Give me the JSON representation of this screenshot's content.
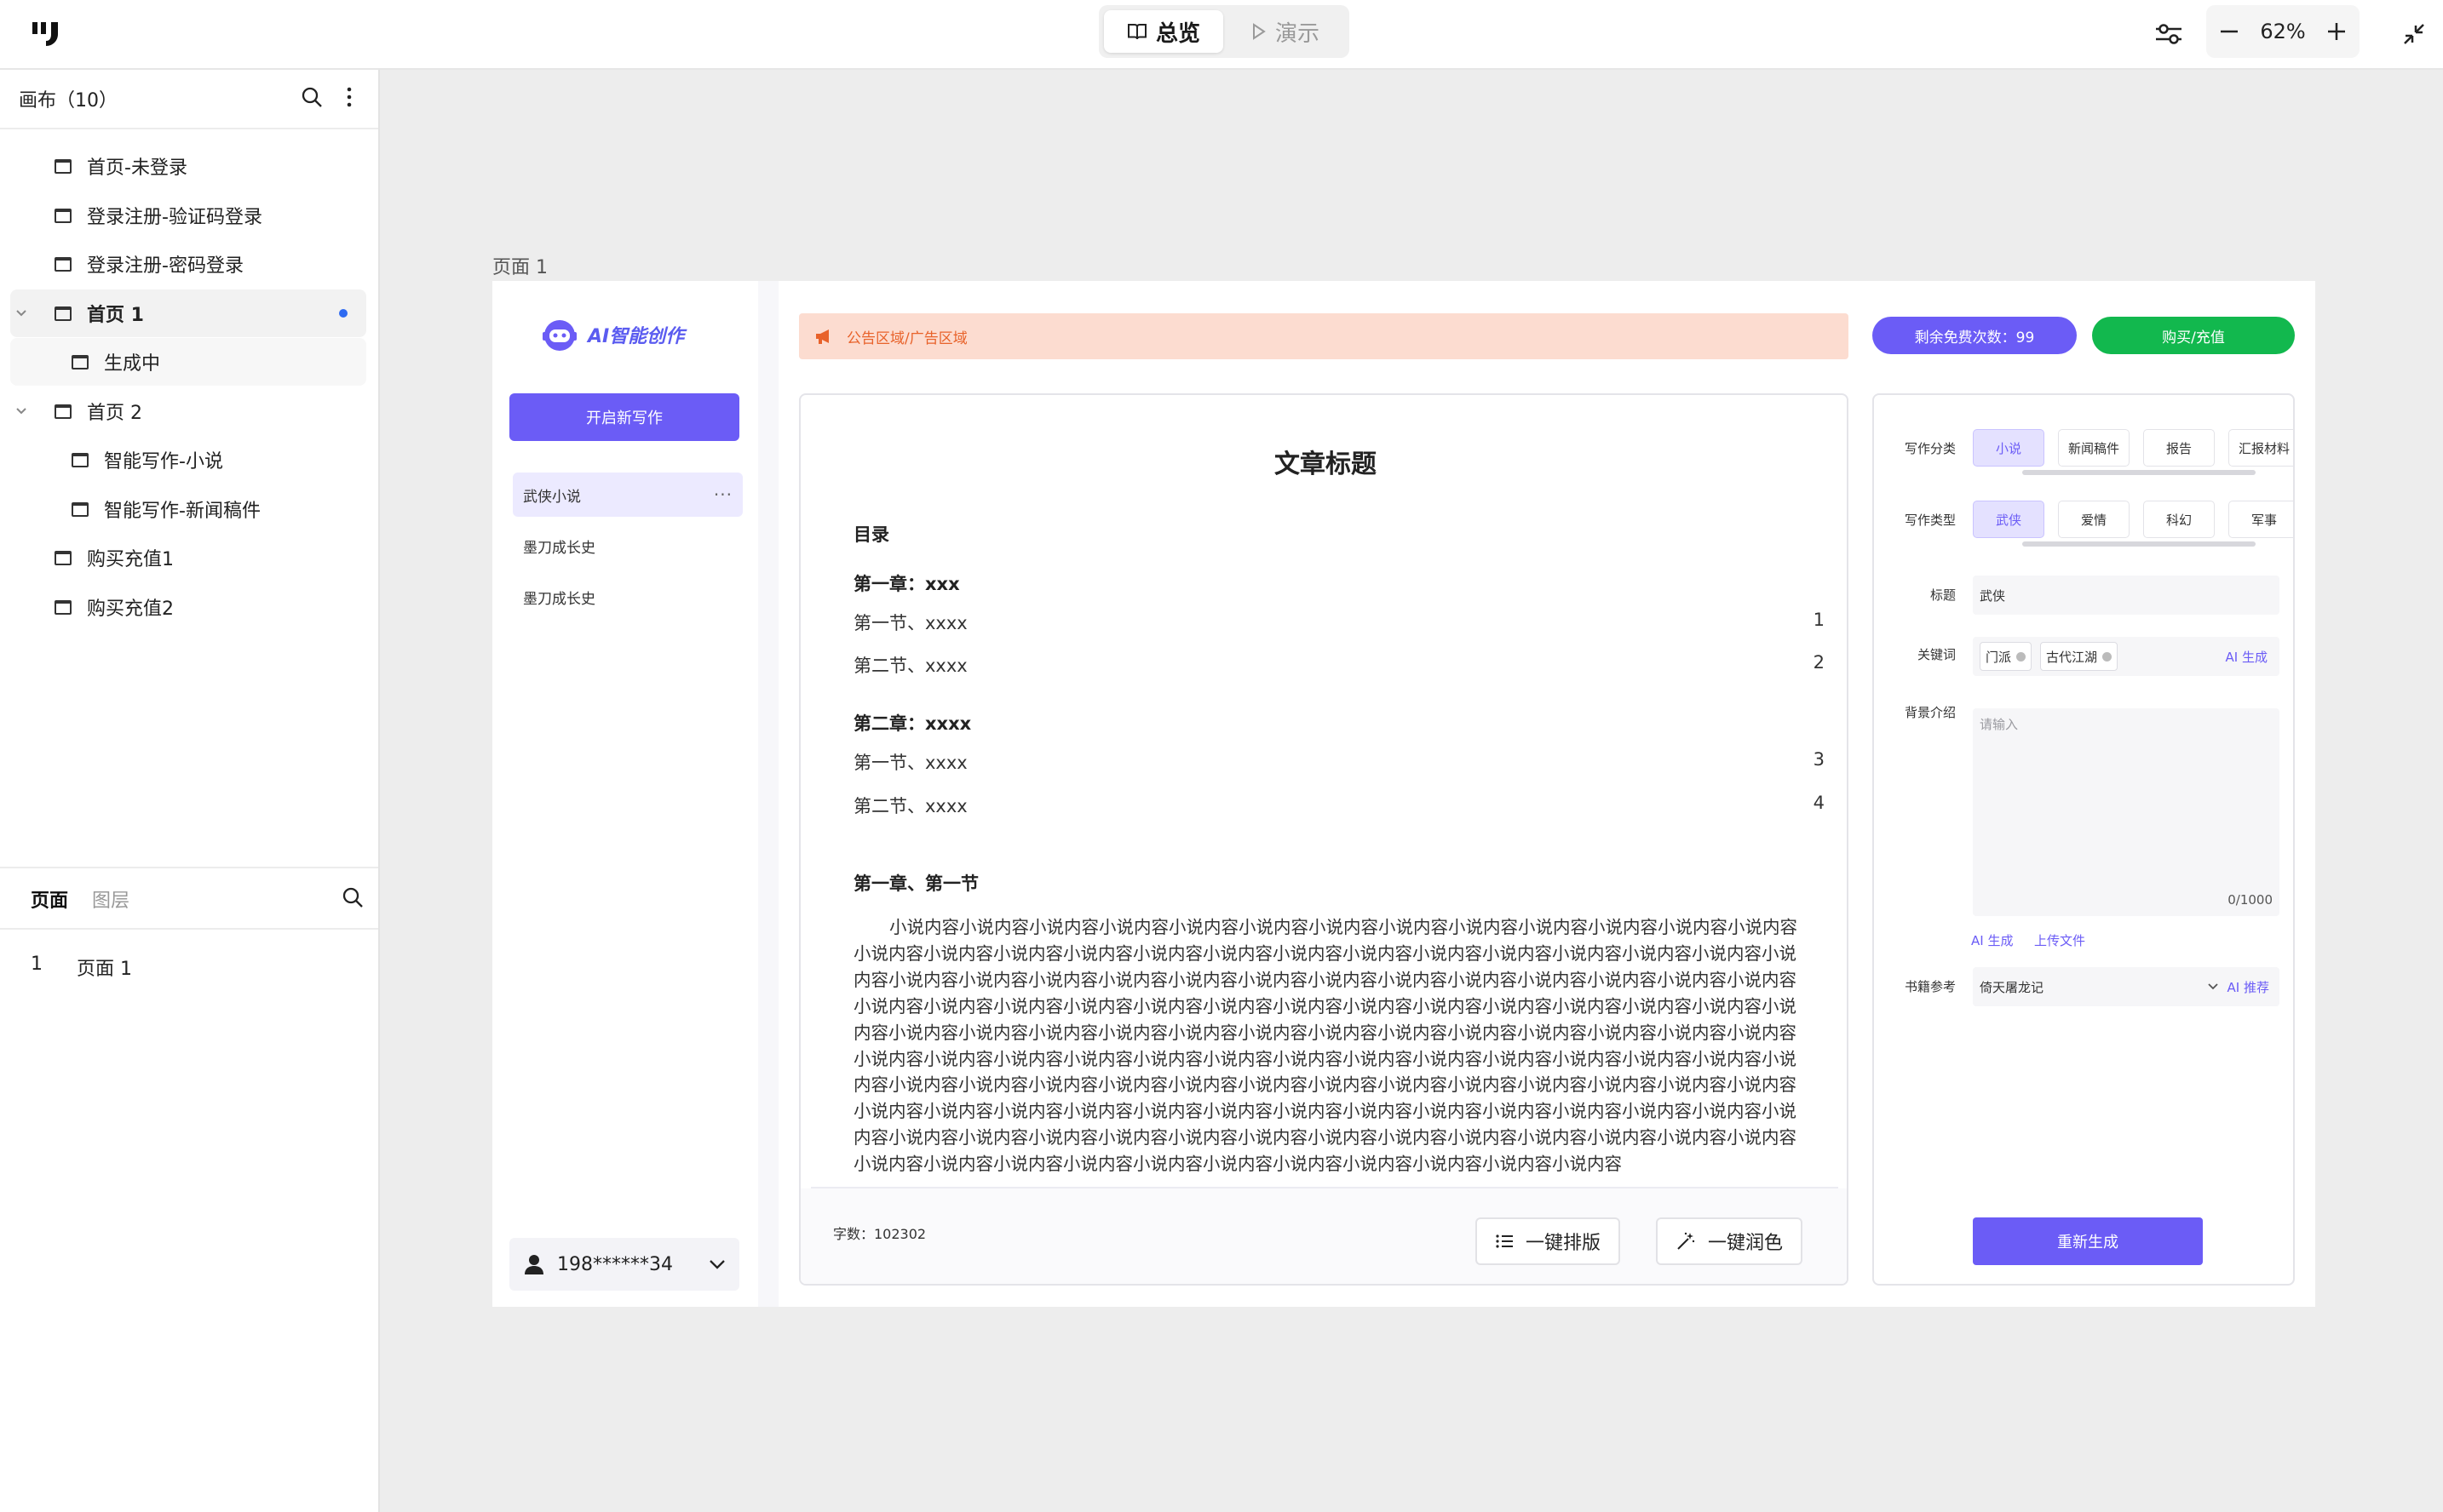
{
  "topbar": {
    "mode_overview": "总览",
    "mode_present": "演示",
    "zoom": "62%"
  },
  "sidebar": {
    "canvas_header": "画布（10）",
    "items": [
      {
        "label": "首页-未登录"
      },
      {
        "label": "登录注册-验证码登录"
      },
      {
        "label": "登录注册-密码登录"
      },
      {
        "label": "首页 1"
      },
      {
        "label": "生成中"
      },
      {
        "label": "首页 2"
      },
      {
        "label": "智能写作-小说"
      },
      {
        "label": "智能写作-新闻稿件"
      },
      {
        "label": "购买充值1"
      },
      {
        "label": "购买充值2"
      }
    ],
    "tabs": {
      "pages": "页面",
      "layers": "图层"
    },
    "page_list": [
      {
        "num": "1",
        "label": "页面 1"
      }
    ]
  },
  "canvas": {
    "frame_label": "页面 1"
  },
  "app": {
    "logo_text": "AI智能创作",
    "new_writing": "开启新写作",
    "history": [
      {
        "label": "武侠小说",
        "more": "···"
      },
      {
        "label": "墨刀成长史"
      },
      {
        "label": "墨刀成长史"
      }
    ],
    "user": "198******34",
    "notice": "公告区域/广告区域",
    "free_count": "剩余免费次数：99",
    "buy": "购买/充值",
    "doc": {
      "title": "文章标题",
      "toc_label": "目录",
      "chapter1": "第一章：xxx",
      "ch1_s1": "第一节、xxxx",
      "ch1_s1_page": "1",
      "ch1_s2": "第二节、xxxx",
      "ch1_s2_page": "2",
      "chapter2": "第二章：xxxx",
      "ch2_s1": "第一节、xxxx",
      "ch2_s1_page": "3",
      "ch2_s2": "第二节、xxxx",
      "ch2_s2_page": "4",
      "section_heading": "第一章、第一节",
      "body": "小说内容小说内容小说内容小说内容小说内容小说内容小说内容小说内容小说内容小说内容小说内容小说内容小说内容小说内容小说内容小说内容小说内容小说内容小说内容小说内容小说内容小说内容小说内容小说内容小说内容小说内容小说内容小说内容小说内容小说内容小说内容小说内容小说内容小说内容小说内容小说内容小说内容小说内容小说内容小说内容小说内容小说内容小说内容小说内容小说内容小说内容小说内容小说内容小说内容小说内容小说内容小说内容小说内容小说内容小说内容小说内容小说内容小说内容小说内容小说内容小说内容小说内容小说内容小说内容小说内容小说内容小说内容小说内容小说内容小说内容小说内容小说内容小说内容小说内容小说内容小说内容小说内容小说内容小说内容小说内容小说内容小说内容小说内容小说内容小说内容小说内容小说内容小说内容小说内容小说内容小说内容小说内容小说内容小说内容小说内容小说内容小说内容小说内容小说内容小说内容小说内容小说内容小说内容小说内容小说内容小说内容小说内容小说内容小说内容小说内容小说内容小说内容小说内容小说内容小说内容小说内容小说内容小说内容小说内容小说内容小说内容小说内容小说内容小说内容小说内容小说内容小说内容小说内容小说内容小说内容小说内容小说内容",
      "word_count": "字数：102302",
      "format_btn": "一键排版",
      "polish_btn": "一键润色"
    },
    "form": {
      "category_label": "写作分类",
      "categories": [
        "小说",
        "新闻稿件",
        "报告",
        "汇报材料"
      ],
      "type_label": "写作类型",
      "types": [
        "武侠",
        "爱情",
        "科幻",
        "军事"
      ],
      "title_label": "标题",
      "title_value": "武侠",
      "keywords_label": "关键词",
      "keywords": [
        "门派",
        "古代江湖"
      ],
      "ai_generate": "AI 生成",
      "background_label": "背景介绍",
      "background_placeholder": "请输入",
      "char_count": "0/1000",
      "ai_generate2": "AI 生成",
      "upload": "上传文件",
      "reference_label": "书籍参考",
      "reference_value": "倚天屠龙记",
      "ai_recommend": "AI 推荐",
      "regenerate": "重新生成"
    },
    "colors": {
      "primary": "#6b5cf6",
      "green": "#12b84e",
      "notice_bg": "#fcdcd0",
      "notice_text": "#e8622a"
    }
  }
}
